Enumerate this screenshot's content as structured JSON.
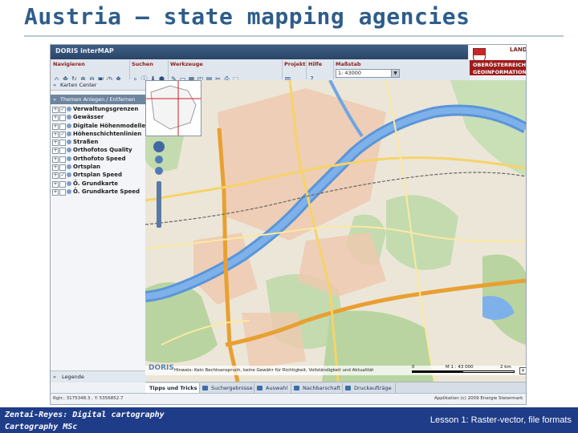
{
  "slide": {
    "title": "Austria – state mapping agencies",
    "footer_left_line1": "Zentai-Reyes: Digital cartography",
    "footer_left_line2": "Cartography MSc",
    "footer_right": "Lesson 1: Raster-vector, file formats"
  },
  "app": {
    "name": "DORIS interMAP",
    "logo": {
      "land": "LAND",
      "line1": "OBERÖSTERREICH",
      "line2": "GEOINFORMATION",
      "crest_icon": "coat-of-arms-icon",
      "colors": {
        "band": "#9e1b1b"
      }
    },
    "toolbar": {
      "groups": [
        {
          "label": "Navigieren",
          "icons": [
            "⌂",
            "✥",
            "↻",
            "⊕",
            "⊖",
            "▣",
            "◷",
            "❖"
          ]
        },
        {
          "label": "Suchen",
          "icons": [
            "⌕",
            "ⓘ",
            "⬇",
            "⬢"
          ]
        },
        {
          "label": "Werkzeuge",
          "icons": [
            "✎",
            "▭",
            "▦",
            "◰",
            "▤",
            "✂",
            "⎙",
            "⬚"
          ]
        },
        {
          "label": "Projekt",
          "icons": [
            "▥"
          ]
        },
        {
          "label": "Hilfe",
          "icons": [
            "?"
          ]
        },
        {
          "label": "Maßstab",
          "icons": []
        }
      ],
      "scale_value": "1:  43000",
      "scale_dropdown": "▼"
    },
    "left_panel": {
      "header": "Karten Center",
      "subheader": "Themen Anlegen / Entfernen",
      "layers": [
        {
          "name": "Verwaltungsgrenzen",
          "checked": true
        },
        {
          "name": "Gewässer",
          "checked": false
        },
        {
          "name": "Digitale Höhenmodelle",
          "checked": false
        },
        {
          "name": "Höhenschichtenlinien",
          "checked": true
        },
        {
          "name": "Straßen",
          "checked": false
        },
        {
          "name": "Orthofotos Quality",
          "checked": false
        },
        {
          "name": "Orthofoto Speed",
          "checked": false
        },
        {
          "name": "Ortsplan",
          "checked": false
        },
        {
          "name": "Ortsplan Speed",
          "checked": true
        },
        {
          "name": "Ö. Grundkarte",
          "checked": false
        },
        {
          "name": "Ö. Grundkarte Speed",
          "checked": false
        }
      ],
      "legend": "Legende"
    },
    "map": {
      "attribution": "Hinweis: Kein Rechtsanspruch, keine Gewähr für Richtigkeit, Vollständigkeit und Aktualität",
      "doris_logo": "DORIS",
      "scale_labels": [
        "0",
        "M 1 : 43 000",
        "2 km"
      ],
      "zoom_plus": "+"
    },
    "tabs": [
      {
        "label": "Tipps und Tricks",
        "active": true
      },
      {
        "label": "Suchergebnisse",
        "active": false
      },
      {
        "label": "Auswahl",
        "active": false
      },
      {
        "label": "Nachbarschaft",
        "active": false
      },
      {
        "label": "Druckaufträge",
        "active": false
      }
    ],
    "status": {
      "coords": "Rgtr.: 3175348.3 , Y: 5356852.7",
      "copyright": "Applikation (c) 2009 Energie Steiermark"
    },
    "side_label": "Legende"
  }
}
